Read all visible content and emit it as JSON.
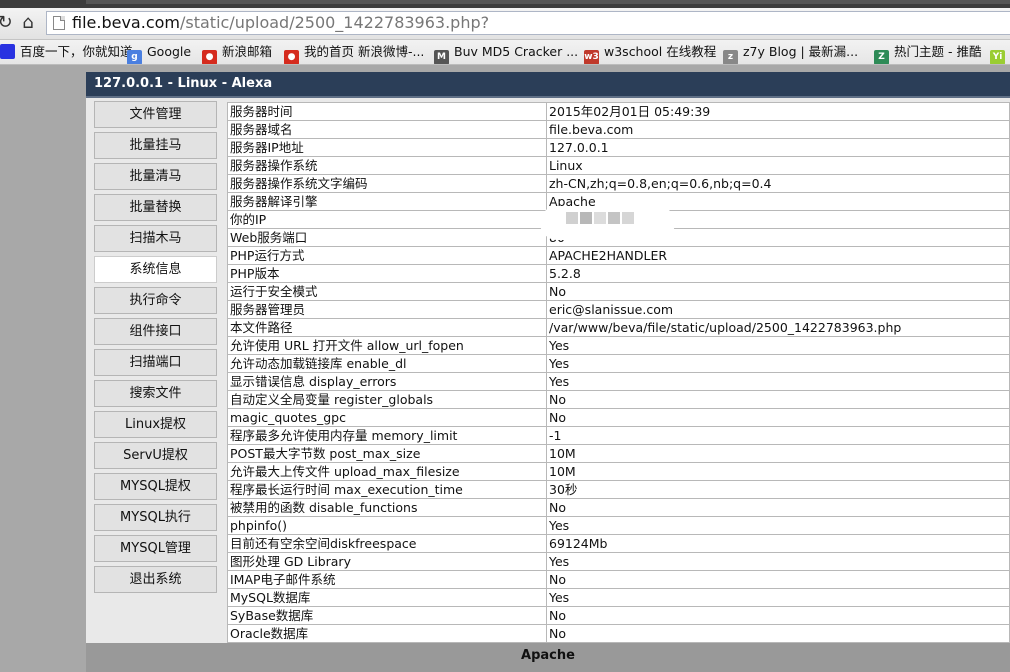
{
  "browser": {
    "url_host": "file.beva.com",
    "url_path": "/static/upload/2500_1422783963.php?",
    "nav_glyphs": {
      "reload": "↻",
      "home": "⌂"
    },
    "bookmarks": [
      {
        "label": "百度一下，你就知道",
        "icon": "baidu-icon",
        "color": "#2932e1",
        "glyph": ""
      },
      {
        "label": "Google",
        "icon": "google-icon",
        "color": "#4a7fe0",
        "glyph": "g"
      },
      {
        "label": "新浪邮箱",
        "icon": "sina-weibo-icon",
        "color": "#d52b1e",
        "glyph": "●"
      },
      {
        "label": "我的首页 新浪微博-...",
        "icon": "sina-weibo-icon",
        "color": "#d52b1e",
        "glyph": "●"
      },
      {
        "label": "Buv MD5 Cracker ...",
        "icon": "md5-icon",
        "color": "#555555",
        "glyph": "M"
      },
      {
        "label": "w3school 在线教程",
        "icon": "w3school-icon",
        "color": "#c0392b",
        "glyph": "w3"
      },
      {
        "label": "z7y Blog | 最新漏...",
        "icon": "z7y-icon",
        "color": "#888888",
        "glyph": "z"
      },
      {
        "label": "热门主题 - 推酷",
        "icon": "tuicool-icon",
        "color": "#2e8b57",
        "glyph": "Z"
      },
      {
        "label": "",
        "icon": "yii-icon",
        "color": "#9acd32",
        "glyph": "Yi"
      }
    ]
  },
  "panel": {
    "header_title": "127.0.0.1 - Linux - Alexa",
    "footer": "Apache",
    "sidebar": [
      {
        "label": "文件管理",
        "active": false
      },
      {
        "label": "批量挂马",
        "active": false
      },
      {
        "label": "批量清马",
        "active": false
      },
      {
        "label": "批量替换",
        "active": false
      },
      {
        "label": "扫描木马",
        "active": false
      },
      {
        "label": "系统信息",
        "active": true
      },
      {
        "label": "执行命令",
        "active": false
      },
      {
        "label": "组件接口",
        "active": false
      },
      {
        "label": "扫描端口",
        "active": false
      },
      {
        "label": "搜索文件",
        "active": false
      },
      {
        "label": "Linux提权",
        "active": false
      },
      {
        "label": "ServU提权",
        "active": false
      },
      {
        "label": "MYSQL提权",
        "active": false
      },
      {
        "label": "MYSQL执行",
        "active": false
      },
      {
        "label": "MYSQL管理",
        "active": false
      },
      {
        "label": "退出系统",
        "active": false
      }
    ],
    "info_rows": [
      {
        "key": "服务器时间",
        "value": "2015年02月01日 05:49:39"
      },
      {
        "key": "服务器域名",
        "value": "file.beva.com"
      },
      {
        "key": "服务器IP地址",
        "value": "127.0.0.1"
      },
      {
        "key": "服务器操作系统",
        "value": "Linux"
      },
      {
        "key": "服务器操作系统文字编码",
        "value": "zh-CN,zh;q=0.8,en;q=0.6,nb;q=0.4"
      },
      {
        "key": "服务器解译引擎",
        "value": "Apache"
      },
      {
        "key": "你的IP",
        "value": ""
      },
      {
        "key": "Web服务端口",
        "value": "80"
      },
      {
        "key": "PHP运行方式",
        "value": "APACHE2HANDLER"
      },
      {
        "key": "PHP版本",
        "value": "5.2.8"
      },
      {
        "key": "运行于安全模式",
        "value": "No"
      },
      {
        "key": "服务器管理员",
        "value": "eric@slanissue.com"
      },
      {
        "key": "本文件路径",
        "value": "/var/www/beva/file/static/upload/2500_1422783963.php"
      },
      {
        "key": "允许使用 URL 打开文件 allow_url_fopen",
        "value": "Yes"
      },
      {
        "key": "允许动态加载链接库 enable_dl",
        "value": "Yes"
      },
      {
        "key": "显示错误信息 display_errors",
        "value": "Yes"
      },
      {
        "key": "自动定义全局变量 register_globals",
        "value": "No"
      },
      {
        "key": "magic_quotes_gpc",
        "value": "No"
      },
      {
        "key": "程序最多允许使用内存量 memory_limit",
        "value": "-1"
      },
      {
        "key": "POST最大字节数 post_max_size",
        "value": "10M"
      },
      {
        "key": "允许最大上传文件 upload_max_filesize",
        "value": "10M"
      },
      {
        "key": "程序最长运行时间 max_execution_time",
        "value": "30秒"
      },
      {
        "key": "被禁用的函数 disable_functions",
        "value": "No"
      },
      {
        "key": "phpinfo()",
        "value": "Yes"
      },
      {
        "key": "目前还有空余空间diskfreespace",
        "value": "69124Mb"
      },
      {
        "key": "图形处理 GD Library",
        "value": "Yes"
      },
      {
        "key": "IMAP电子邮件系统",
        "value": "No"
      },
      {
        "key": "MySQL数据库",
        "value": "Yes"
      },
      {
        "key": "SyBase数据库",
        "value": "No"
      },
      {
        "key": "Oracle数据库",
        "value": "No"
      }
    ]
  }
}
